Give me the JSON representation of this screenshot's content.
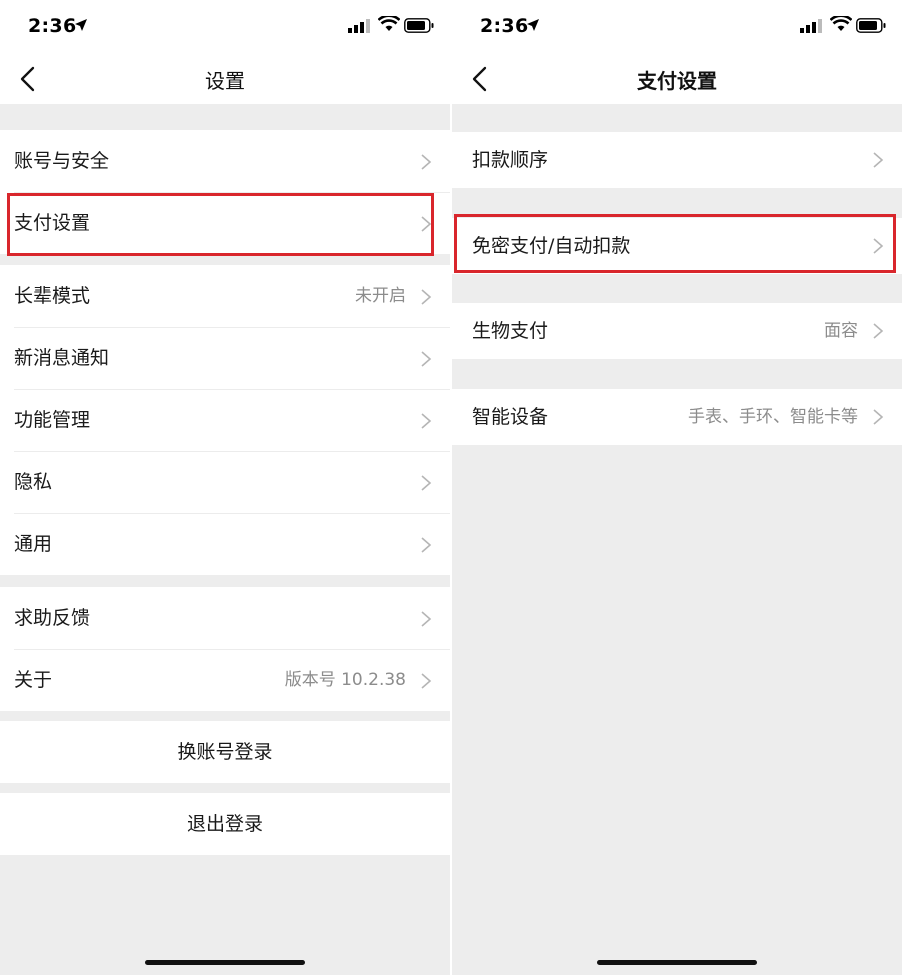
{
  "status_bar": {
    "time": "2:36"
  },
  "settings": {
    "title": "设置",
    "group1": [
      {
        "label": "账号与安全",
        "value": ""
      },
      {
        "label": "支付设置",
        "value": ""
      }
    ],
    "group2": [
      {
        "label": "长辈模式",
        "value": "未开启"
      },
      {
        "label": "新消息通知",
        "value": ""
      },
      {
        "label": "功能管理",
        "value": ""
      },
      {
        "label": "隐私",
        "value": ""
      },
      {
        "label": "通用",
        "value": ""
      }
    ],
    "group3": [
      {
        "label": "求助反馈",
        "value": ""
      },
      {
        "label": "关于",
        "value": "版本号 10.2.38"
      }
    ],
    "switch_account": "换账号登录",
    "logout": "退出登录"
  },
  "payment": {
    "title": "支付设置",
    "items": [
      {
        "label": "扣款顺序",
        "value": ""
      },
      {
        "label": "免密支付/自动扣款",
        "value": ""
      },
      {
        "label": "生物支付",
        "value": "面容"
      },
      {
        "label": "智能设备",
        "value": "手表、手环、智能卡等"
      }
    ]
  },
  "colors": {
    "highlight": "#d9262c",
    "background": "#ededed",
    "card": "#ffffff"
  },
  "icons": [
    "back-chevron-icon",
    "right-chevron-icon",
    "location-arrow-icon",
    "cellular-signal-icon",
    "wifi-icon",
    "battery-icon"
  ]
}
